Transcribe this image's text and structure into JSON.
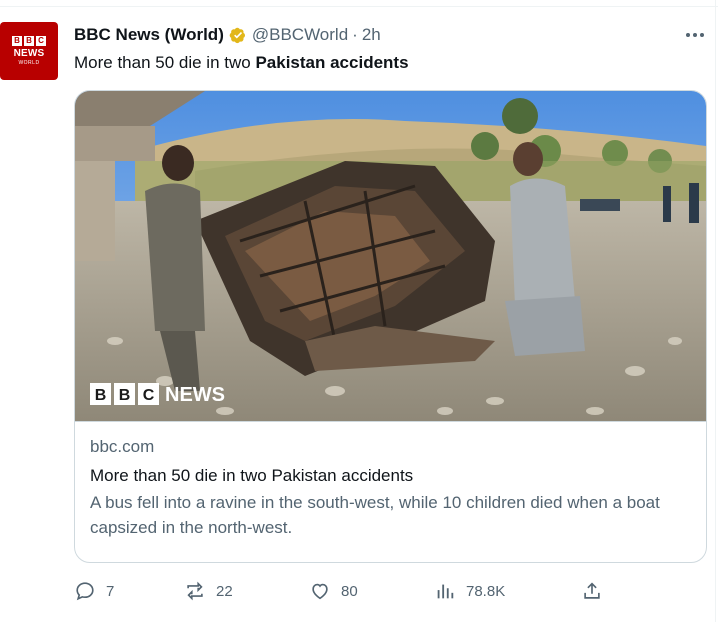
{
  "tweet": {
    "author_name": "BBC News (World)",
    "handle": "@BBCWorld",
    "separator": "·",
    "time": "2h",
    "avatar": {
      "bbc": [
        "B",
        "B",
        "C"
      ],
      "news": "NEWS",
      "world": "WORLD"
    },
    "text_prefix": "More than 50 die in two ",
    "text_bold": "Pakistan accidents"
  },
  "card": {
    "image_watermark_blocks": [
      "B",
      "B",
      "C"
    ],
    "image_watermark_news": "NEWS",
    "domain": "bbc.com",
    "title": "More than 50 die in two Pakistan accidents",
    "description": "A bus fell into a ravine in the south-west, while 10 children died when a boat capsized in the north-west."
  },
  "actions": {
    "replies": "7",
    "reposts": "22",
    "likes": "80",
    "views": "78.8K"
  },
  "colors": {
    "brand": "#b80000",
    "verified_badge": "#e2b719",
    "secondary_text": "#536471",
    "border": "#cfd9de"
  },
  "icons": [
    "verified-badge-icon",
    "more-icon",
    "reply-icon",
    "repost-icon",
    "like-icon",
    "views-icon",
    "share-icon"
  ]
}
